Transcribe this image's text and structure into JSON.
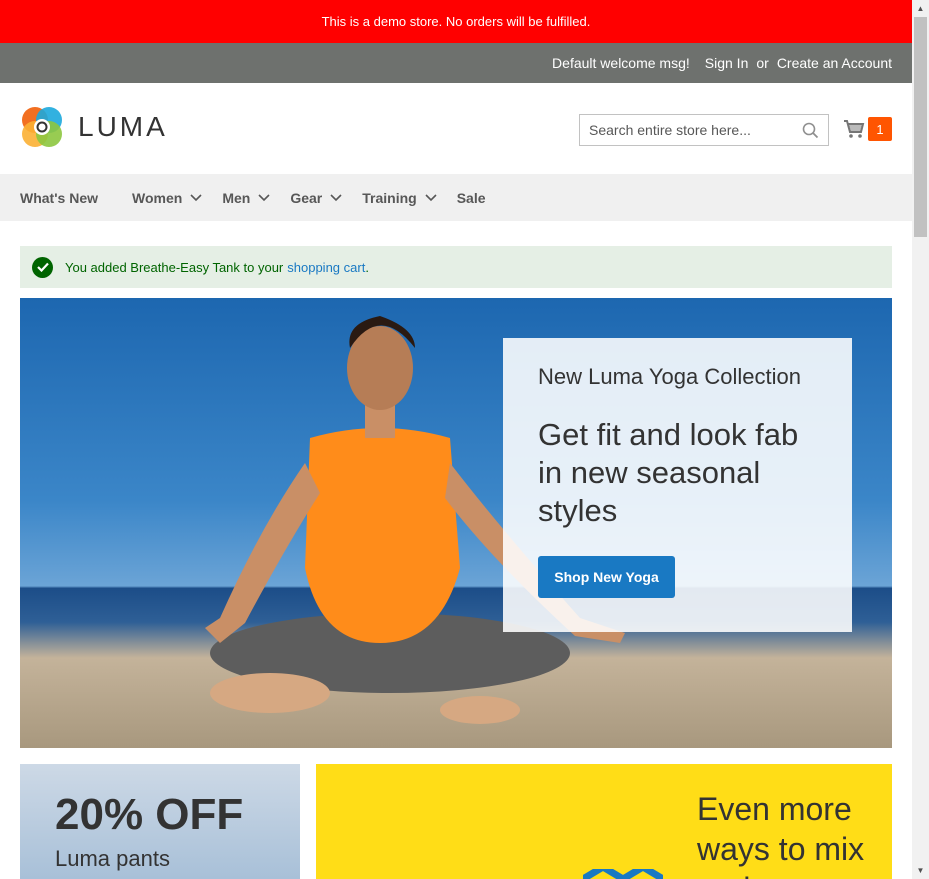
{
  "demo_notice": "This is a demo store. No orders will be fulfilled.",
  "panel": {
    "welcome": "Default welcome msg!",
    "sign_in": "Sign In",
    "or": "or",
    "create_account": "Create an Account"
  },
  "logo": {
    "text": "LUMA"
  },
  "search": {
    "placeholder": "Search entire store here..."
  },
  "cart": {
    "count": "1"
  },
  "nav": {
    "items": [
      {
        "label": "What's New"
      },
      {
        "label": "Women"
      },
      {
        "label": "Men"
      },
      {
        "label": "Gear"
      },
      {
        "label": "Training"
      },
      {
        "label": "Sale"
      }
    ]
  },
  "message": {
    "text": "You added Breathe-Easy Tank to your",
    "link": "shopping cart",
    "suffix": "."
  },
  "hero": {
    "subtitle": "New Luma Yoga Collection",
    "title": "Get fit and look fab in new seasonal styles",
    "button": "Shop New Yoga"
  },
  "promo_left": {
    "headline": "20% OFF",
    "subline": "Luma pants"
  },
  "promo_right": {
    "text": "Even more ways to mix and"
  },
  "colors": {
    "accent": "#1979c3",
    "notice": "#ff0000",
    "cart_badge": "#ff5501",
    "promo_yellow": "#ffdd17"
  }
}
